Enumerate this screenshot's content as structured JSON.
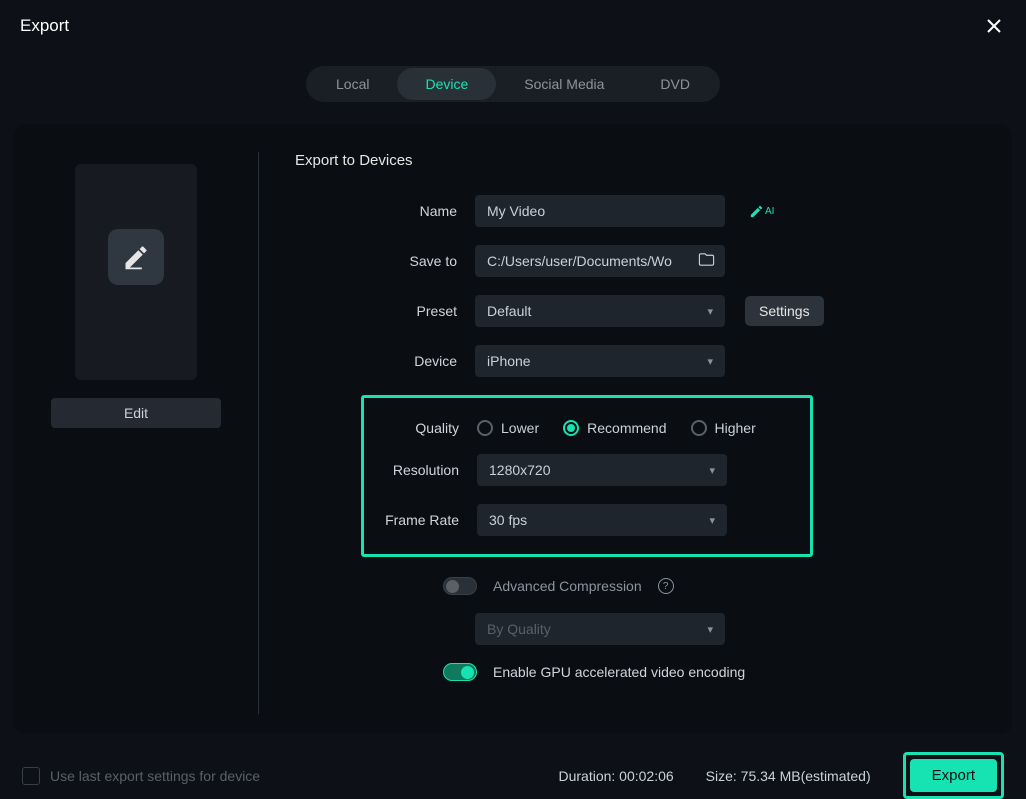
{
  "header": {
    "title": "Export"
  },
  "tabs": {
    "items": [
      {
        "label": "Local"
      },
      {
        "label": "Device"
      },
      {
        "label": "Social Media"
      },
      {
        "label": "DVD"
      }
    ]
  },
  "sidebar": {
    "edit_label": "Edit"
  },
  "form": {
    "section_title": "Export to Devices",
    "name_label": "Name",
    "name_value": "My Video",
    "saveto_label": "Save to",
    "saveto_value": "C:/Users/user/Documents/Wo",
    "preset_label": "Preset",
    "preset_value": "Default",
    "settings_label": "Settings",
    "device_label": "Device",
    "device_value": "iPhone",
    "quality_label": "Quality",
    "quality_options": [
      {
        "label": "Lower"
      },
      {
        "label": "Recommend"
      },
      {
        "label": "Higher"
      }
    ],
    "resolution_label": "Resolution",
    "resolution_value": "1280x720",
    "framerate_label": "Frame Rate",
    "framerate_value": "30 fps",
    "adv_compression_label": "Advanced Compression",
    "compression_mode": "By Quality",
    "gpu_label": "Enable GPU accelerated video encoding"
  },
  "footer": {
    "remember_label": "Use last export settings for device",
    "duration_label": "Duration: 00:02:06",
    "size_label": "Size: 75.34 MB(estimated)",
    "export_label": "Export"
  }
}
